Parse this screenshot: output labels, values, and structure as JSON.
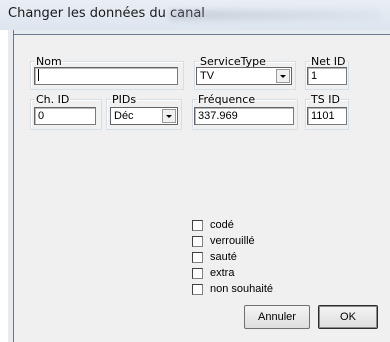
{
  "window": {
    "title": "Changer les données du canal"
  },
  "fields": {
    "nom": {
      "label": "Nom",
      "value": ""
    },
    "service_type": {
      "label": "ServiceType",
      "value": "TV"
    },
    "net_id": {
      "label": "Net ID",
      "value": "1"
    },
    "ch_id": {
      "label": "Ch. ID",
      "value": "0"
    },
    "pids": {
      "label": "PIDs",
      "value": "Déc"
    },
    "frequence": {
      "label": "Fréquence",
      "value": "337.969"
    },
    "ts_id": {
      "label": "TS ID",
      "value": "1101"
    }
  },
  "options": [
    {
      "label": "codé",
      "checked": false
    },
    {
      "label": "verrouillé",
      "checked": false
    },
    {
      "label": "sauté",
      "checked": false
    },
    {
      "label": "extra",
      "checked": false
    },
    {
      "label": "non souhaité",
      "checked": false
    }
  ],
  "buttons": {
    "cancel": "Annuler",
    "ok": "OK"
  }
}
